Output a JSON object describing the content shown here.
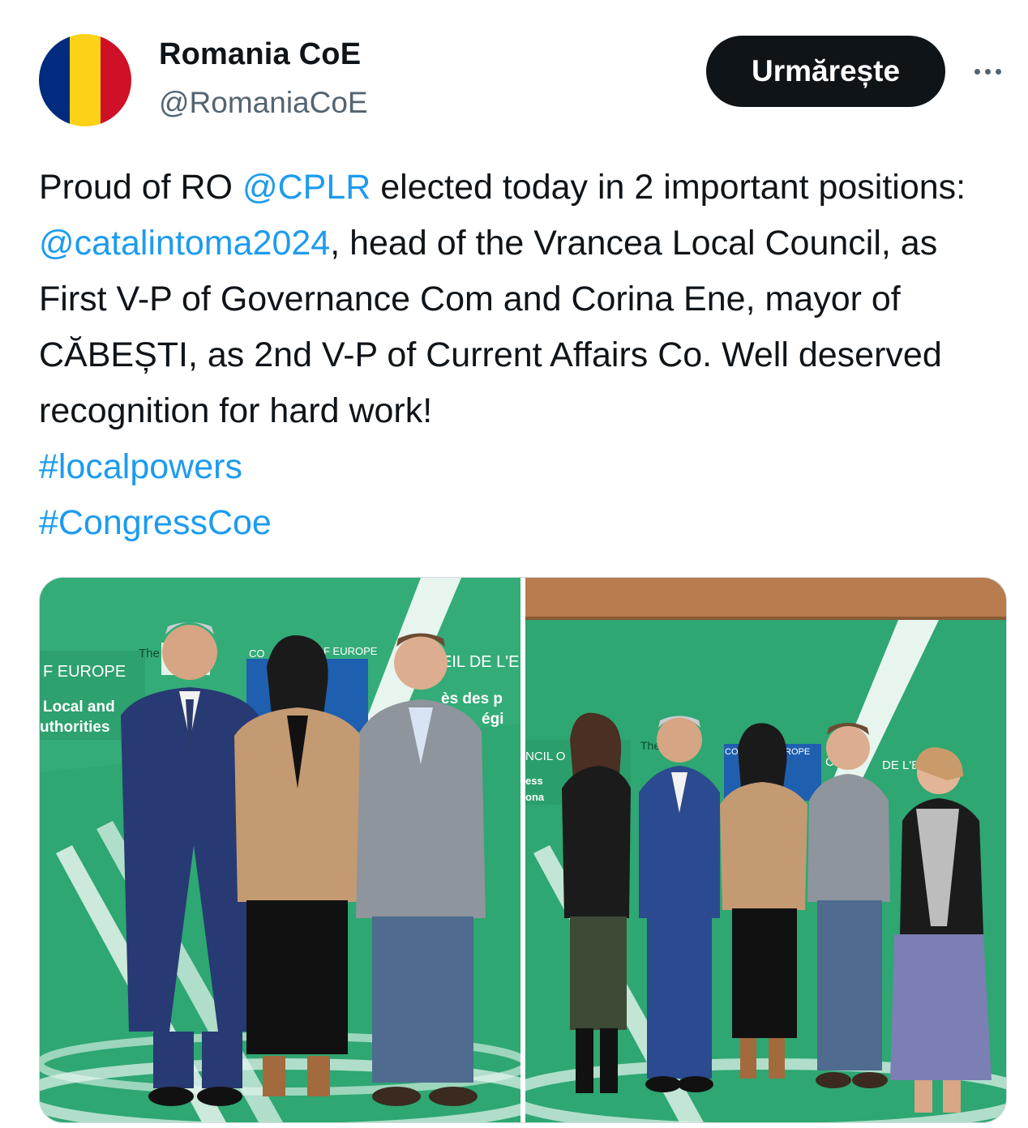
{
  "account": {
    "name": "Romania CoE",
    "handle": "@RomaniaCoE",
    "avatar_colors": [
      "#002b7f",
      "#fcd116",
      "#ce1126"
    ]
  },
  "follow_button": {
    "label": "Urmărește"
  },
  "more_icon": "more-horizontal-icon",
  "tweet": {
    "t1": "Proud of RO ",
    "m1": "@CPLR",
    "t2": " elected today in 2 important positions: ",
    "m2": "@catalintoma2024",
    "t3": ", head of the Vrancea Local Council, as First V-P of Governance Com and Corina Ene, mayor of CĂBEȘTI, as 2nd V-P of Current Affairs Co. Well deserved recognition for hard work!",
    "hashtags": [
      "#localpowers",
      "#CongressCoe"
    ]
  },
  "photos": {
    "left": {
      "banner_texts": [
        "F EUROPE",
        "Local and",
        "uthorities",
        "The",
        "CO",
        "F EUROPE",
        "EIL DE L'E",
        "ès des p",
        "égi"
      ]
    },
    "right": {
      "banner_texts": [
        "NCIL O",
        "The C",
        "COUN",
        "ROPE",
        "CO",
        "DE L'EU",
        "ess",
        "ona"
      ]
    }
  },
  "colors": {
    "accent": "#1d9bf0",
    "text": "#0f1419",
    "muted": "#536471",
    "banner_green": "#2ea772"
  }
}
